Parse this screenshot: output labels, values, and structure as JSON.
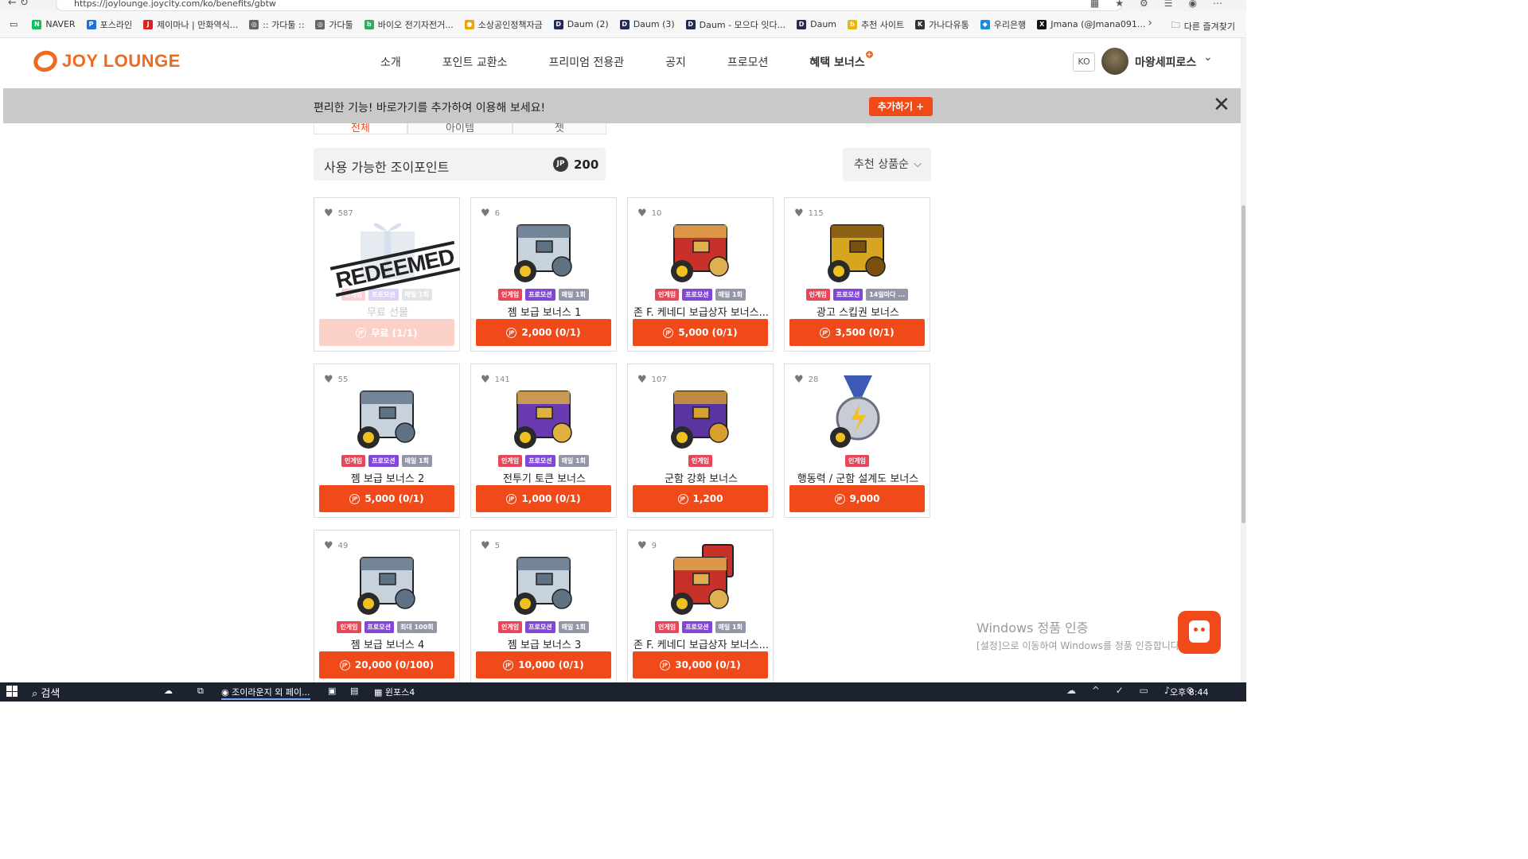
{
  "browser": {
    "url": "https://joylounge.joycity.com/ko/benefits/gbtw"
  },
  "bookmarks": [
    {
      "label": "NAVER",
      "color": "#03c75a",
      "letter": "N"
    },
    {
      "label": "포스라인",
      "color": "#1e6fd9",
      "letter": "P"
    },
    {
      "label": "제이마나 | 만화역식...",
      "color": "#e02020",
      "letter": "J"
    },
    {
      "label": ":: 가다툴 ::",
      "color": "#666666",
      "letter": "◎"
    },
    {
      "label": "가다툴",
      "color": "#666666",
      "letter": "◎"
    },
    {
      "label": "바이오 전기자전거...",
      "color": "#2fae4e",
      "letter": "b"
    },
    {
      "label": "소상공인정책자금",
      "color": "#f2a400",
      "letter": "●"
    },
    {
      "label": "Daum (2)",
      "color": "#222a5a",
      "letter": "D"
    },
    {
      "label": "Daum (3)",
      "color": "#222a5a",
      "letter": "D"
    },
    {
      "label": "Daum - 모으다 잇다...",
      "color": "#222a5a",
      "letter": "D"
    },
    {
      "label": "Daum",
      "color": "#222a5a",
      "letter": "D"
    },
    {
      "label": "추천 사이트",
      "color": "#f2b400",
      "letter": "b"
    },
    {
      "label": "가나다유통",
      "color": "#333333",
      "letter": "K"
    },
    {
      "label": "우리은행",
      "color": "#1a8fd8",
      "letter": "◆"
    },
    {
      "label": "Jmana (@Jmana091...",
      "color": "#111111",
      "letter": "X"
    }
  ],
  "bookmarks_other": "다른 즐겨찾기",
  "header": {
    "logo": "JOY LOUNGE",
    "nav": [
      "소개",
      "포인트 교환소",
      "프리미엄 전용관",
      "공지",
      "프로모션",
      "혜택 보너스"
    ],
    "lang": "KO",
    "user_name": "마왕세피로스"
  },
  "banner": {
    "message": "편리한 기능! 바로가기를 추가하여 이용해 보세요!",
    "add_button": "추가하기 +"
  },
  "tabs": [
    "전체",
    "아이템",
    "젯"
  ],
  "points": {
    "label": "사용 가능한 조이포인트",
    "jp": "JP",
    "value": "200"
  },
  "sort": {
    "selected": "추천 상품순"
  },
  "products": [
    {
      "likes": "587",
      "tags": [
        [
          "인게임",
          "ingame"
        ],
        [
          "프로모션",
          "promo"
        ],
        [
          "매일 1회",
          "limit"
        ]
      ],
      "name": "무료 선물",
      "price": "무료 (1/1)",
      "redeemed": true,
      "art": "gift"
    },
    {
      "likes": "6",
      "tags": [
        [
          "인게임",
          "ingame"
        ],
        [
          "프로모션",
          "promo"
        ],
        [
          "매일 1회",
          "limit"
        ]
      ],
      "name": "젬 보급 보너스 1",
      "price": "2,000 (0/1)",
      "art": "steel"
    },
    {
      "likes": "10",
      "tags": [
        [
          "인게임",
          "ingame"
        ],
        [
          "프로모션",
          "promo"
        ],
        [
          "매일 1회",
          "limit"
        ]
      ],
      "name": "존 F. 케네디 보급상자 보너스...",
      "price": "5,000 (0/1)",
      "art": "red"
    },
    {
      "likes": "115",
      "tags": [
        [
          "인게임",
          "ingame"
        ],
        [
          "프로모션",
          "promo"
        ],
        [
          "14일마다 ...",
          "limit"
        ]
      ],
      "name": "광고 스킵권 보너스",
      "price": "3,500 (0/1)",
      "art": "gold"
    },
    {
      "likes": "55",
      "tags": [
        [
          "인게임",
          "ingame"
        ],
        [
          "프로모션",
          "promo"
        ],
        [
          "매일 1회",
          "limit"
        ]
      ],
      "name": "젬 보급 보너스 2",
      "price": "5,000 (0/1)",
      "art": "steel"
    },
    {
      "likes": "141",
      "tags": [
        [
          "인게임",
          "ingame"
        ],
        [
          "프로모션",
          "promo"
        ],
        [
          "매일 1회",
          "limit"
        ]
      ],
      "name": "전투기 토큰 보너스",
      "price": "1,000 (0/1)",
      "art": "purple-gold"
    },
    {
      "likes": "107",
      "tags": [
        [
          "인게임",
          "ingame"
        ]
      ],
      "name": "군함 강화 보너스",
      "price": "1,200",
      "art": "purple-anchor"
    },
    {
      "likes": "28",
      "tags": [
        [
          "인게임",
          "ingame"
        ]
      ],
      "name": "행동력 / 군함 설계도 보너스",
      "price": "9,000",
      "art": "medal"
    },
    {
      "likes": "49",
      "tags": [
        [
          "인게임",
          "ingame"
        ],
        [
          "프로모션",
          "promo"
        ],
        [
          "최대 100회",
          "limit"
        ]
      ],
      "name": "젬 보급 보너스 4",
      "price": "20,000 (0/100)",
      "art": "steel"
    },
    {
      "likes": "5",
      "tags": [
        [
          "인게임",
          "ingame"
        ],
        [
          "프로모션",
          "promo"
        ],
        [
          "매일 1회",
          "limit"
        ]
      ],
      "name": "젬 보급 보너스 3",
      "price": "10,000 (0/1)",
      "art": "steel"
    },
    {
      "likes": "9",
      "tags": [
        [
          "인게임",
          "ingame"
        ],
        [
          "프로모션",
          "promo"
        ],
        [
          "매일 1회",
          "limit"
        ]
      ],
      "name": "존 F. 케네디 보급상자 보너스...",
      "price": "30,000 (0/1)",
      "art": "red-double"
    }
  ],
  "redeemed_stamp": "REDEEMED",
  "windows_watermark": {
    "title": "Windows 정품 인증",
    "subtitle": "[설정]으로 이동하여 Windows를 정품 인증합니다."
  },
  "taskbar": {
    "search": "검색",
    "app1": "조이라운지 외 페이...",
    "app2": "윈포스4",
    "clock": "오후 8:44"
  },
  "colors": {
    "accent": "#f04a1a",
    "brand": "#f06a1d"
  }
}
